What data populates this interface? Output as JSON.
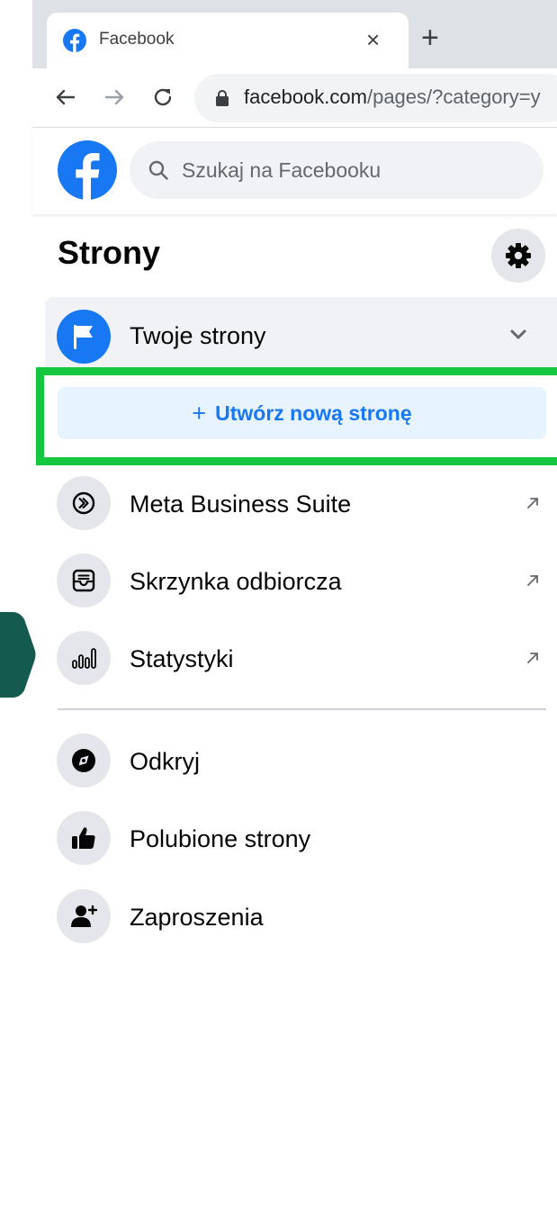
{
  "browser": {
    "tab_title": "Facebook",
    "tab_close_glyph": "×",
    "new_tab_glyph": "+",
    "url_host": "facebook.com",
    "url_path": "/pages/?category=y"
  },
  "header": {
    "search_placeholder": "Szukaj na Facebooku"
  },
  "sidebar": {
    "title": "Strony",
    "your_pages_label": "Twoje strony",
    "create_button_plus": "+",
    "create_button_label": "Utwórz nową stronę",
    "tools": [
      {
        "label": "Meta Business Suite",
        "icon": "meta-business-suite-icon",
        "external": true
      },
      {
        "label": "Skrzynka odbiorcza",
        "icon": "inbox-icon",
        "external": true
      },
      {
        "label": "Statystyki",
        "icon": "insights-icon",
        "external": true
      }
    ],
    "browse": [
      {
        "label": "Odkryj",
        "icon": "compass-icon"
      },
      {
        "label": "Polubione strony",
        "icon": "thumbs-up-icon"
      },
      {
        "label": "Zaproszenia",
        "icon": "person-add-icon"
      }
    ]
  },
  "colors": {
    "facebook_blue": "#1877f2",
    "highlight_green": "#14c73f",
    "side_arrow": "#155a4e",
    "icon_circle": "#e4e6eb"
  }
}
